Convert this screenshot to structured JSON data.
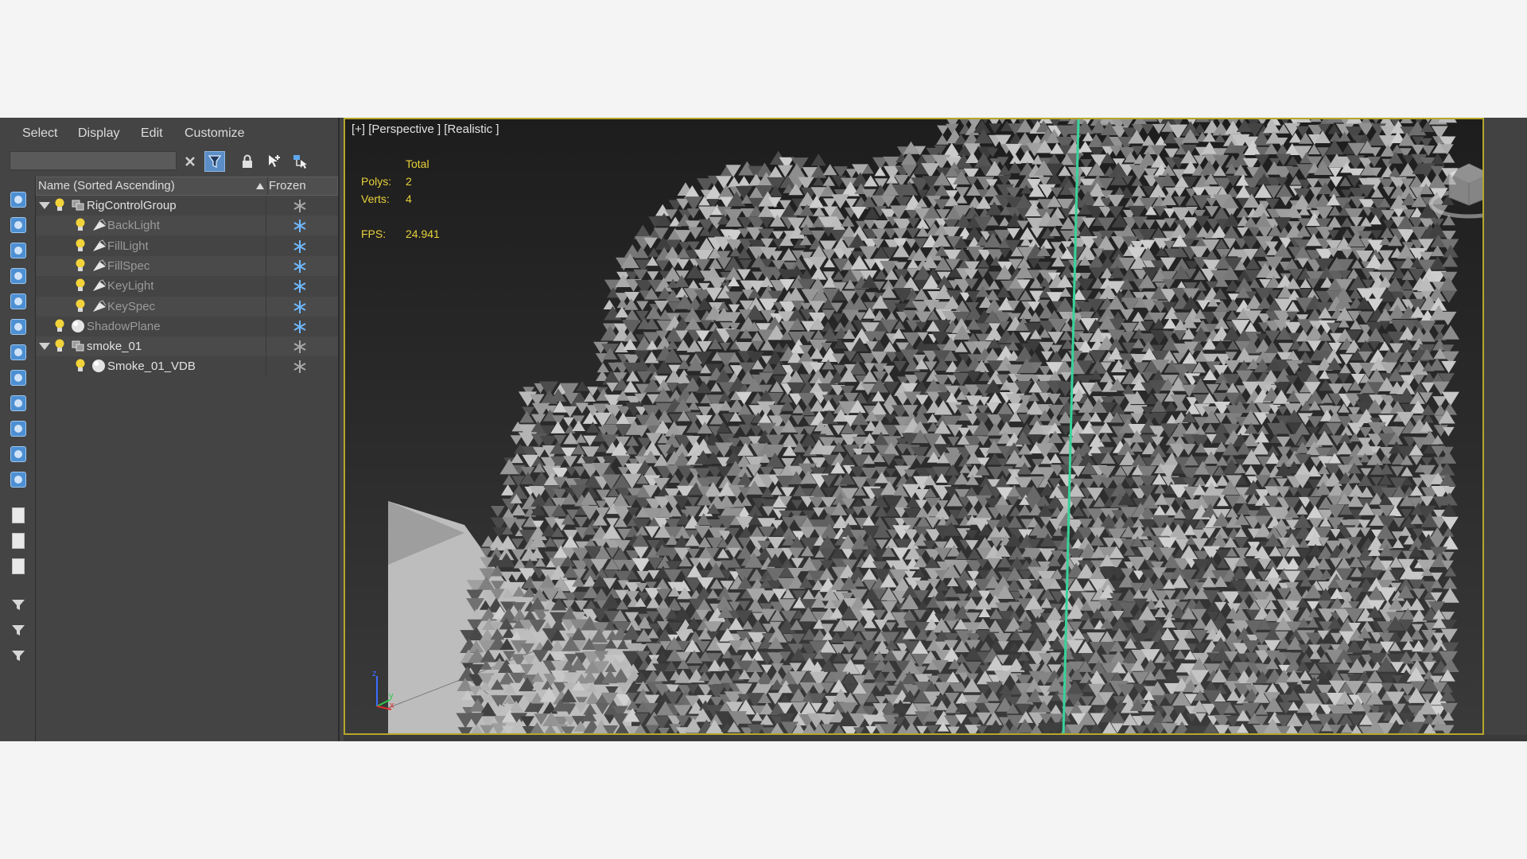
{
  "explorer": {
    "menu": [
      "Select",
      "Display",
      "Edit",
      "Customize"
    ],
    "search": {
      "value": "",
      "placeholder": ""
    },
    "toolbar_icons": [
      "clear-x-icon",
      "filter-display-icon",
      "lock-icon",
      "add-to-selection-icon",
      "select-children-icon"
    ],
    "sidebar_icons": [
      "display-geometry-icon",
      "display-shapes-icon",
      "display-lights-icon",
      "display-cameras-icon",
      "display-helpers-icon",
      "display-spacewarps-icon",
      "display-groups-icon",
      "display-xrefs-icon",
      "display-bones-icon",
      "display-containers-icon",
      "display-frozen-icon",
      "display-hidden-icon",
      "display-all-icon",
      "display-none-icon",
      "display-invert-icon",
      "filter-icon",
      "filter-options-icon",
      "collapse-icon"
    ],
    "columns": {
      "name": "Name (Sorted Ascending)",
      "frozen": "Frozen"
    },
    "rows": [
      {
        "label": "RigControlGroup",
        "depth": 0,
        "expandable": true,
        "icon": "group-icon",
        "dim": false,
        "frozen": false
      },
      {
        "label": "BackLight",
        "depth": 1,
        "expandable": false,
        "icon": "light-icon",
        "dim": true,
        "frozen": true
      },
      {
        "label": "FillLight",
        "depth": 1,
        "expandable": false,
        "icon": "light-icon",
        "dim": true,
        "frozen": true
      },
      {
        "label": "FillSpec",
        "depth": 1,
        "expandable": false,
        "icon": "light-icon",
        "dim": true,
        "frozen": true
      },
      {
        "label": "KeyLight",
        "depth": 1,
        "expandable": false,
        "icon": "light-icon",
        "dim": true,
        "frozen": true
      },
      {
        "label": "KeySpec",
        "depth": 1,
        "expandable": false,
        "icon": "light-icon",
        "dim": true,
        "frozen": true
      },
      {
        "label": "ShadowPlane",
        "depth": 0,
        "expandable": false,
        "icon": "sphere-icon",
        "dim": true,
        "frozen": true
      },
      {
        "label": "smoke_01",
        "depth": 0,
        "expandable": true,
        "icon": "group-icon",
        "dim": false,
        "frozen": false
      },
      {
        "label": "Smoke_01_VDB",
        "depth": 1,
        "expandable": false,
        "icon": "sphere-icon",
        "dim": false,
        "frozen": false
      }
    ]
  },
  "viewport": {
    "label": "[+] [Perspective ] [Realistic ]",
    "stats": {
      "total_label": "Total",
      "polys_label": "Polys:",
      "polys_value": "2",
      "verts_label": "Verts:",
      "verts_value": "4",
      "fps_label": "FPS:",
      "fps_value": "24.941"
    },
    "axis": {
      "z": "z",
      "y": "y",
      "x": "x"
    }
  },
  "colors": {
    "panel_bg": "#444444",
    "accent_blue": "#4d8fd2",
    "frozen_active": "#6fb8ff",
    "stats_yellow": "#e8d23a",
    "viewport_border": "#b6a62b",
    "bulb_yellow": "#f2d33a"
  }
}
